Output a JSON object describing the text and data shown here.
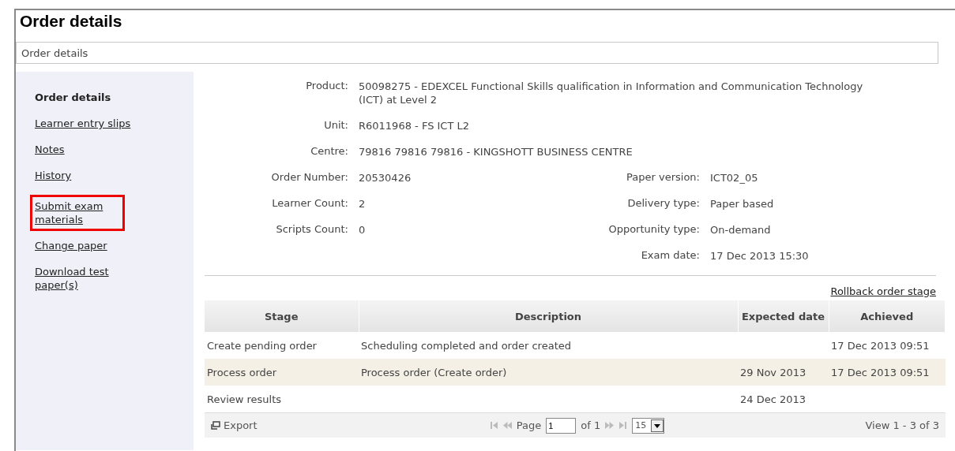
{
  "page_title": "Order details",
  "breadcrumb": "Order details",
  "sidebar": {
    "items": [
      {
        "label": "Order details",
        "selected": true,
        "outlined": false
      },
      {
        "label": "Learner entry slips",
        "selected": false,
        "outlined": false
      },
      {
        "label": "Notes",
        "selected": false,
        "outlined": false
      },
      {
        "label": "History",
        "selected": false,
        "outlined": false
      },
      {
        "label": "Submit exam materials",
        "selected": false,
        "outlined": true
      },
      {
        "label": "Change paper",
        "selected": false,
        "outlined": false
      },
      {
        "label": "Download test paper(s)",
        "selected": false,
        "outlined": false
      }
    ]
  },
  "details_full": [
    {
      "label": "Product:",
      "value": "50098275 - EDEXCEL Functional Skills qualification in Information and Communication Technology (ICT) at Level 2"
    },
    {
      "label": "Unit:",
      "value": "R6011968 - FS ICT L2"
    },
    {
      "label": "Centre:",
      "value": "79816 79816 79816 - KINGSHOTT BUSINESS CENTRE"
    }
  ],
  "details_left": [
    {
      "label": "Order Number:",
      "value": "20530426"
    },
    {
      "label": "Learner Count:",
      "value": "2"
    },
    {
      "label": "Scripts Count:",
      "value": "0"
    }
  ],
  "details_right": [
    {
      "label": "Paper version:",
      "value": "ICT02_05"
    },
    {
      "label": "Delivery type:",
      "value": "Paper based"
    },
    {
      "label": "Opportunity type:",
      "value": "On-demand"
    },
    {
      "label": "Exam date:",
      "value": "17 Dec 2013 15:30"
    }
  ],
  "rollback_link": "Rollback order stage",
  "table": {
    "columns": [
      "Stage",
      "Description",
      "Expected date",
      "Achieved"
    ],
    "rows": [
      {
        "cells": [
          "Create pending order",
          "Scheduling completed and order created",
          "",
          "17 Dec 2013 09:51"
        ],
        "highlighted": false
      },
      {
        "cells": [
          "Process order",
          "Process order (Create order)",
          "29 Nov 2013",
          "17 Dec 2013 09:51"
        ],
        "highlighted": true
      },
      {
        "cells": [
          "Review results",
          "",
          "24 Dec 2013",
          ""
        ],
        "highlighted": false
      }
    ]
  },
  "pager": {
    "export": "Export",
    "page_label": "Page",
    "page_value": "1",
    "of_label": "of 1",
    "page_size": "15",
    "view_text": "View 1 - 3 of 3"
  }
}
